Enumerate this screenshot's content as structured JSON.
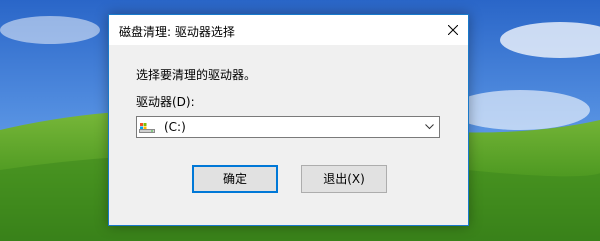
{
  "dialog": {
    "title": "磁盘清理: 驱动器选择",
    "prompt": "选择要清理的驱动器。",
    "drive_label": "驱动器(D):",
    "selected_drive": "(C:)",
    "ok_label": "确定",
    "exit_label": "退出(X)"
  },
  "icons": {
    "close": "close-icon",
    "drive": "drive-icon",
    "dropdown": "chevron-down-icon"
  },
  "colors": {
    "dialog_border": "#1979ca",
    "default_button_border": "#0078d7",
    "sky": "#4d8ae0",
    "grass": "#3f8a1e"
  }
}
